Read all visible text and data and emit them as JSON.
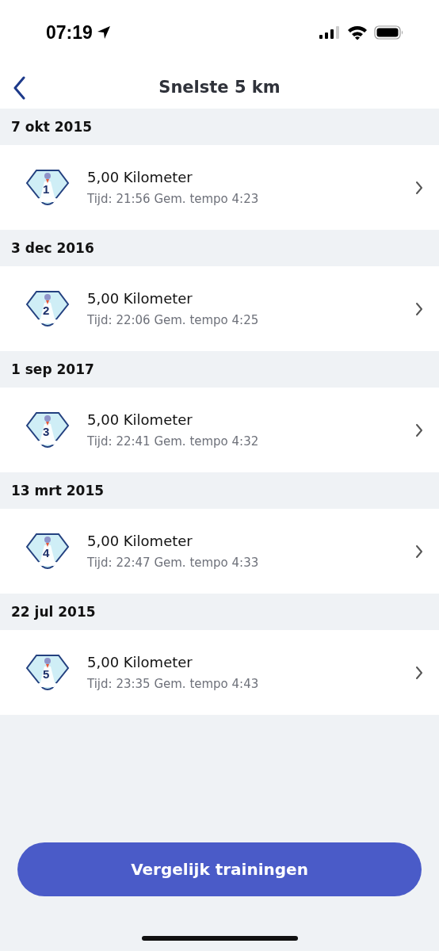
{
  "status_bar": {
    "time": "07:19"
  },
  "nav": {
    "title": "Snelste 5 km"
  },
  "records": [
    {
      "date": "7 okt 2015",
      "rank": "1",
      "distance": "5,00 Kilometer",
      "detail": "Tijd: 21:56 Gem. tempo 4:23"
    },
    {
      "date": "3 dec 2016",
      "rank": "2",
      "distance": "5,00 Kilometer",
      "detail": "Tijd: 22:06 Gem. tempo 4:25"
    },
    {
      "date": "1 sep 2017",
      "rank": "3",
      "distance": "5,00 Kilometer",
      "detail": "Tijd: 22:41 Gem. tempo 4:32"
    },
    {
      "date": "13 mrt 2015",
      "rank": "4",
      "distance": "5,00 Kilometer",
      "detail": "Tijd: 22:47 Gem. tempo 4:33"
    },
    {
      "date": "22 jul 2015",
      "rank": "5",
      "distance": "5,00 Kilometer",
      "detail": "Tijd: 23:35 Gem. tempo 4:43"
    }
  ],
  "compare_button": {
    "label": "Vergelijk trainingen"
  }
}
